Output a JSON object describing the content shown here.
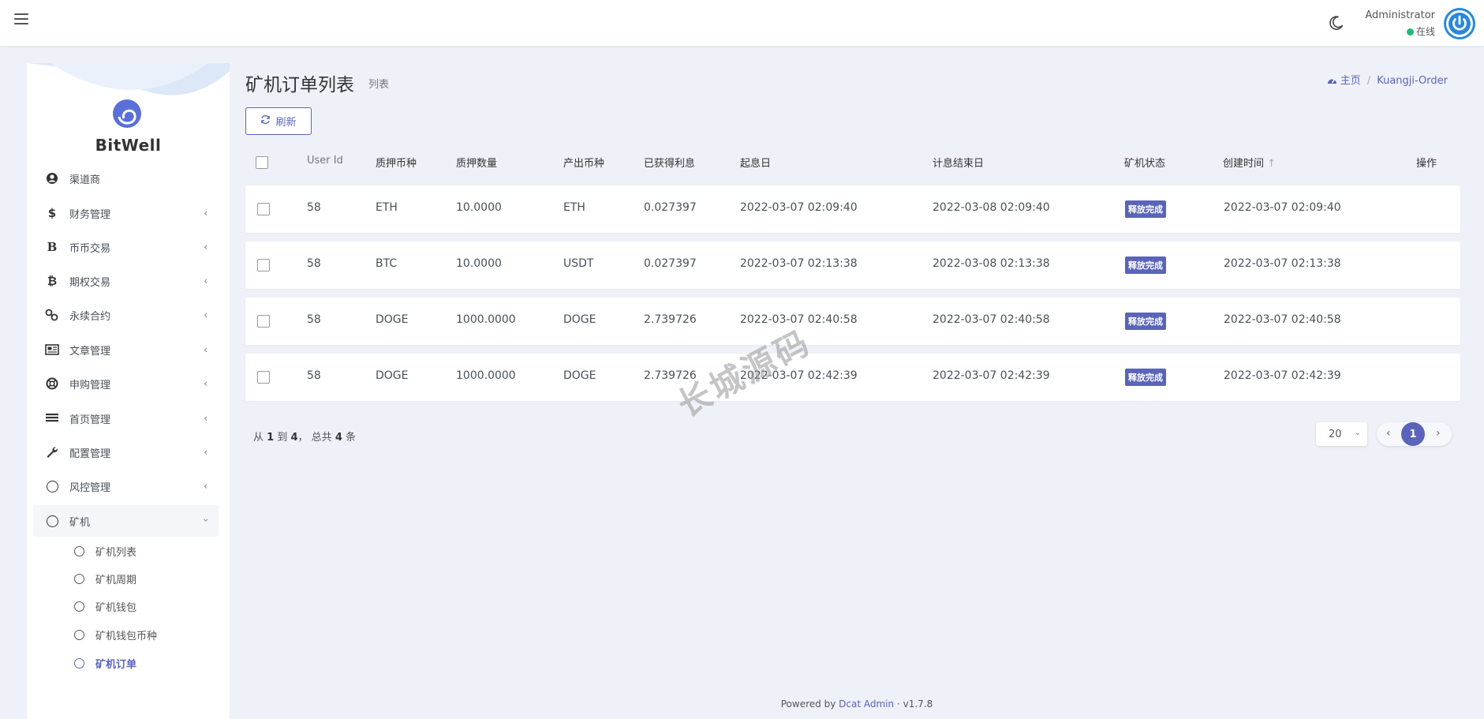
{
  "navbar": {
    "user_name": "Administrator",
    "user_status": "在线"
  },
  "sidebar": {
    "brand": "BitWell",
    "items": [
      {
        "label": "渠道商",
        "icon": "user-circle-icon",
        "glyph": "●"
      },
      {
        "label": "财务管理",
        "icon": "dollar-icon",
        "glyph": "$"
      },
      {
        "label": "币币交易",
        "icon": "b-letter-icon",
        "glyph": "B"
      },
      {
        "label": "期权交易",
        "icon": "bitcoin-icon",
        "glyph": "₿"
      },
      {
        "label": "永续合约",
        "icon": "link-icon",
        "glyph": "⚭"
      },
      {
        "label": "文章管理",
        "icon": "newspaper-icon",
        "glyph": "▤"
      },
      {
        "label": "申购管理",
        "icon": "lifebuoy-icon",
        "glyph": "⊕"
      },
      {
        "label": "首页管理",
        "icon": "list-icon",
        "glyph": "≡"
      },
      {
        "label": "配置管理",
        "icon": "wrench-icon",
        "glyph": "🔧"
      },
      {
        "label": "风控管理",
        "icon": "circle-icon",
        "glyph": "○"
      },
      {
        "label": "矿机",
        "icon": "circle-icon",
        "glyph": "○"
      }
    ],
    "sub_items": [
      "矿机列表",
      "矿机周期",
      "矿机钱包",
      "矿机钱包币种",
      "矿机订单"
    ]
  },
  "page": {
    "title": "矿机订单列表",
    "subtitle": "列表",
    "breadcrumb_home": "主页",
    "breadcrumb_current": "Kuangji-Order",
    "refresh_label": "刷新"
  },
  "table": {
    "headers": [
      "User Id",
      "质押币种",
      "质押数量",
      "产出币种",
      "已获得利息",
      "起息日",
      "计息结束日",
      "矿机状态",
      "创建时间",
      "操作"
    ],
    "rows": [
      [
        "58",
        "ETH",
        "10.0000",
        "ETH",
        "0.027397",
        "2022-03-07 02:09:40",
        "2022-03-08 02:09:40",
        "释放完成",
        "2022-03-07 02:09:40"
      ],
      [
        "58",
        "BTC",
        "10.0000",
        "USDT",
        "0.027397",
        "2022-03-07 02:13:38",
        "2022-03-08 02:13:38",
        "释放完成",
        "2022-03-07 02:13:38"
      ],
      [
        "58",
        "DOGE",
        "1000.0000",
        "DOGE",
        "2.739726",
        "2022-03-07 02:40:58",
        "2022-03-07 02:40:58",
        "释放完成",
        "2022-03-07 02:40:58"
      ],
      [
        "58",
        "DOGE",
        "1000.0000",
        "DOGE",
        "2.739726",
        "2022-03-07 02:42:39",
        "2022-03-07 02:42:39",
        "释放完成",
        "2022-03-07 02:42:39"
      ]
    ]
  },
  "pagination": {
    "info_from": "从",
    "info_start": "1",
    "info_to": "到",
    "info_end": "4",
    "info_total_prefix": "， 总共",
    "info_total": "4",
    "info_unit": "条",
    "per_page": "20",
    "current": "1"
  },
  "footer": {
    "powered": "Powered by",
    "link": "Dcat Admin",
    "dot": "·",
    "version": "v1.7.8"
  },
  "watermark": "长城源码",
  "colors": {
    "accent": "#5a64b8",
    "online": "#21b978",
    "avatar": "#2a88d8"
  }
}
